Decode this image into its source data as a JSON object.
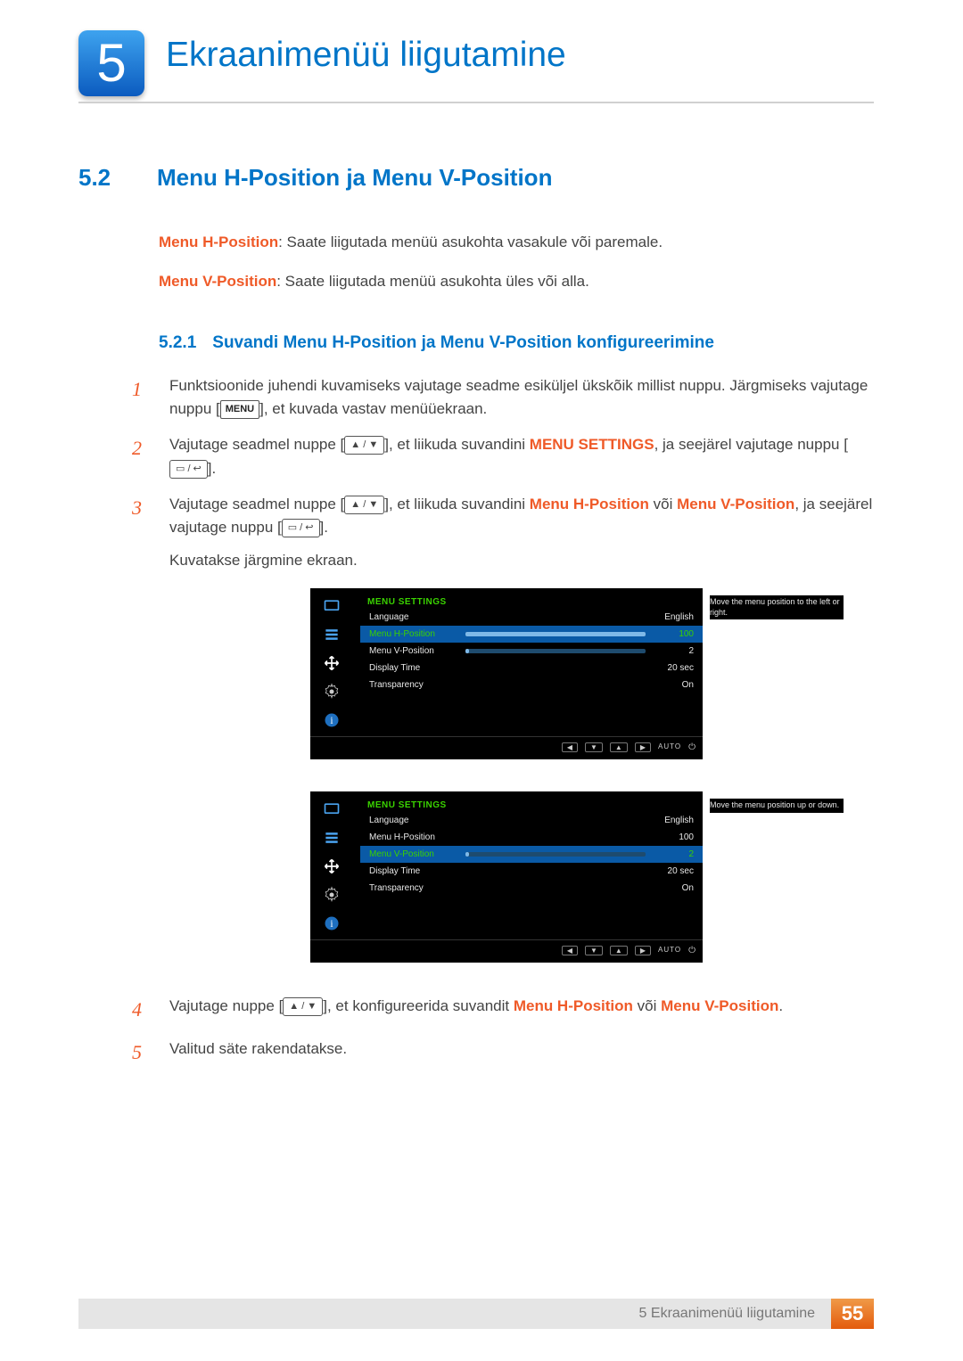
{
  "chapter": {
    "number": "5",
    "title": "Ekraanimenüü liigutamine"
  },
  "section": {
    "number": "5.2",
    "title": "Menu H-Position ja Menu V-Position"
  },
  "intro": {
    "hpos_label": "Menu H-Position",
    "hpos_desc": ": Saate liigutada menüü asukohta vasakule või paremale.",
    "vpos_label": "Menu V-Position",
    "vpos_desc": ": Saate liigutada menüü asukohta üles või alla."
  },
  "subsection": {
    "number": "5.2.1",
    "title": "Suvandi Menu H-Position ja Menu V-Position konfigureerimine"
  },
  "steps": {
    "s1_a": "Funktsioonide juhendi kuvamiseks vajutage seadme esiküljel ükskõik millist nuppu. Järgmiseks vajutage nuppu [",
    "s1_menu": "MENU",
    "s1_b": "], et kuvada vastav menüüekraan.",
    "s2_a": "Vajutage seadmel nuppe [",
    "s2_b": "], et liikuda suvandini ",
    "s2_hl": "MENU SETTINGS",
    "s2_c": ", ja seejärel vajutage nuppu [",
    "s2_d": "].",
    "s3_a": "Vajutage seadmel nuppe [",
    "s3_b": "], et liikuda suvandini ",
    "s3_hl1": "Menu H-Position",
    "s3_mid": " või ",
    "s3_hl2": "Menu V-Position",
    "s3_c": ", ja seejärel vajutage nuppu [",
    "s3_d": "].",
    "s3_e": "Kuvatakse järgmine ekraan.",
    "s4_a": "Vajutage nuppe [",
    "s4_b": "], et konfigureerida suvandit ",
    "s4_hl1": "Menu H-Position",
    "s4_mid": " või ",
    "s4_hl2": "Menu V-Position",
    "s4_c": ".",
    "s5": "Valitud säte rakendatakse."
  },
  "osd": {
    "title": "MENU SETTINGS",
    "help_h": "Move the menu position to the left or right.",
    "help_v": "Move the menu position up or down.",
    "nav_auto": "AUTO",
    "items": {
      "language": {
        "label": "Language",
        "value": "English"
      },
      "h": {
        "label": "Menu H-Position",
        "value": "100",
        "fill": "100%"
      },
      "v": {
        "label": "Menu V-Position",
        "value": "2",
        "fill": "2%"
      },
      "dt": {
        "label": "Display Time",
        "value": "20 sec"
      },
      "tr": {
        "label": "Transparency",
        "value": "On"
      }
    }
  },
  "footer": {
    "text": "5 Ekraanimenüü liigutamine",
    "page": "55"
  }
}
